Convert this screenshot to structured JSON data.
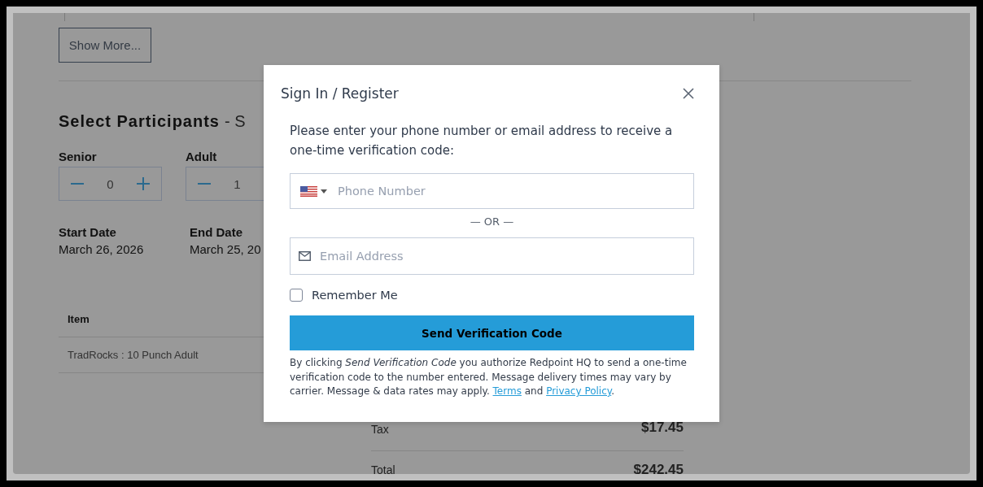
{
  "page": {
    "show_more": "Show More...",
    "section_title": "Select Participants",
    "section_subtitle": "- S",
    "participants": [
      {
        "label": "Senior",
        "value": "0"
      },
      {
        "label": "Adult",
        "value": "1"
      }
    ],
    "dates": [
      {
        "label": "Start Date",
        "value": "March 26, 2026"
      },
      {
        "label": "End Date",
        "value": "March 25, 20"
      }
    ],
    "table": {
      "columns": [
        "Item"
      ],
      "rows": [
        [
          "TradRocks : 10 Punch Adult"
        ]
      ]
    },
    "summary": [
      {
        "label": "Tax",
        "amount": "$17.45"
      },
      {
        "label": "Total",
        "amount": "$242.45"
      }
    ]
  },
  "modal": {
    "title": "Sign In / Register",
    "prompt": "Please enter your phone number or email address to receive a one-time verification code:",
    "phone": {
      "placeholder": "Phone Number"
    },
    "separator": "— OR —",
    "email": {
      "placeholder": "Email Address"
    },
    "remember_me": {
      "label": "Remember Me",
      "checked": false
    },
    "submit": "Send Verification Code",
    "disclaimer": "By clicking *Send Verification Code* you authorize Redpoint HQ to send a one-time verification code to the number entered. Message delivery times may vary by carrier. Message & data rates may apply.",
    "links": [
      {
        "label": "Terms"
      },
      {
        "label": "Privacy Policy"
      }
    ],
    "links_joiner": "and",
    "end_mark": "."
  }
}
